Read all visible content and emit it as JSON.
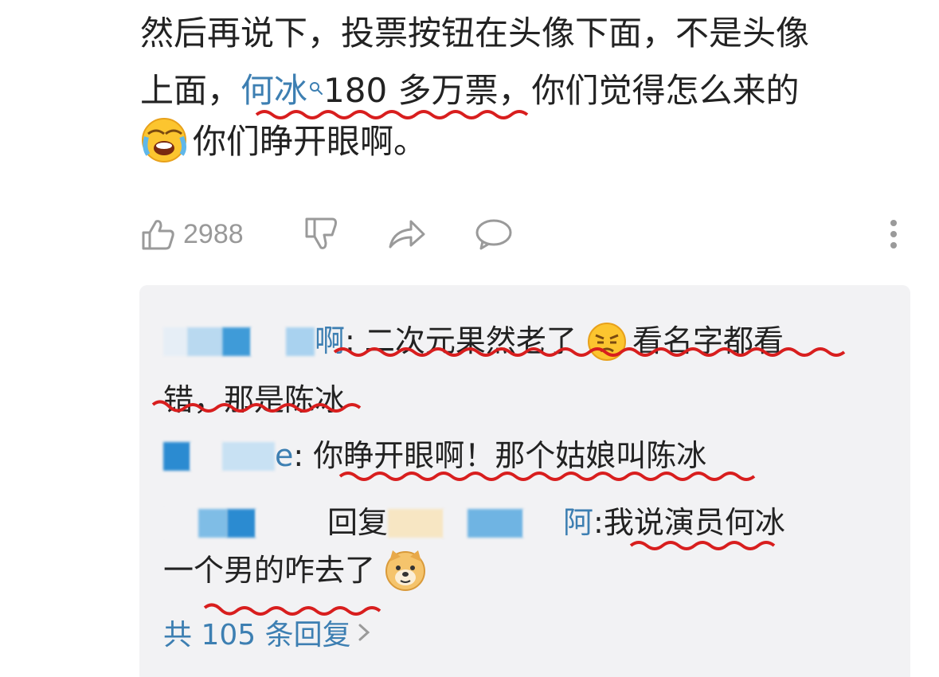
{
  "post": {
    "line1": "然后再说下，投票按钮在头像下面，不是头像",
    "line2_prefix": "上面，",
    "mention": "何冰",
    "line2_suffix": "180 多万票，你们觉得怎么来的",
    "line3": "你们睁开眼啊。"
  },
  "actions": {
    "like_count": "2988"
  },
  "replies": [
    {
      "username_visible": "啊",
      "text_line1": ": 二次元果然老了",
      "text_line1b": "看名字都看",
      "text_line2": "错，那是陈冰"
    },
    {
      "username_visible": "e",
      "text": ": 你睁开眼啊！那个姑娘叫陈冰"
    },
    {
      "reply_word": "回复",
      "target_visible": "阿",
      "text_line1": ":我说演员何冰",
      "text_line2": "一个男的咋去了"
    }
  ],
  "more_replies_label": "共 105 条回复",
  "colors": {
    "link": "#3d7fb2",
    "underline": "#d81e1e",
    "reply_bg": "#f2f2f4",
    "icon_gray": "#9a9a9a"
  },
  "icons": [
    "search-icon",
    "laughing-cry-emoji",
    "thumbs-up-icon",
    "thumbs-down-icon",
    "share-icon",
    "comment-icon",
    "more-vertical-icon",
    "annoyed-emoji",
    "doge-emoji",
    "chevron-right-icon"
  ]
}
